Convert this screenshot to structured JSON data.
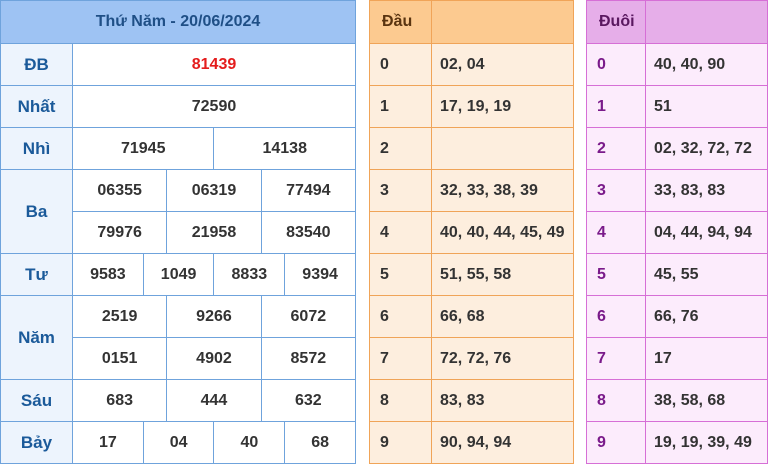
{
  "results": {
    "title": "Thứ Năm - 20/06/2024",
    "rows": {
      "db": {
        "label": "ĐB",
        "values": [
          "81439"
        ]
      },
      "nhat": {
        "label": "Nhất",
        "values": [
          "72590"
        ]
      },
      "nhi": {
        "label": "Nhì",
        "values": [
          "71945",
          "14138"
        ]
      },
      "ba": {
        "label": "Ba",
        "values": [
          "06355",
          "06319",
          "77494",
          "79976",
          "21958",
          "83540"
        ]
      },
      "tu": {
        "label": "Tư",
        "values": [
          "9583",
          "1049",
          "8833",
          "9394"
        ]
      },
      "nam": {
        "label": "Năm",
        "values": [
          "2519",
          "9266",
          "6072",
          "0151",
          "4902",
          "8572"
        ]
      },
      "sau": {
        "label": "Sáu",
        "values": [
          "683",
          "444",
          "632"
        ]
      },
      "bay": {
        "label": "Bảy",
        "values": [
          "17",
          "04",
          "40",
          "68"
        ]
      }
    },
    "special_color": "#e41c1c"
  },
  "dau": {
    "header": "Đầu",
    "rows": [
      {
        "k": "0",
        "v": "02, 04"
      },
      {
        "k": "1",
        "v": "17, 19, 19"
      },
      {
        "k": "2",
        "v": ""
      },
      {
        "k": "3",
        "v": "32, 33, 38, 39"
      },
      {
        "k": "4",
        "v": "40, 40, 44, 45, 49"
      },
      {
        "k": "5",
        "v": "51, 55, 58"
      },
      {
        "k": "6",
        "v": "66, 68"
      },
      {
        "k": "7",
        "v": "72, 72, 76"
      },
      {
        "k": "8",
        "v": "83, 83"
      },
      {
        "k": "9",
        "v": "90, 94, 94"
      }
    ]
  },
  "duoi": {
    "header": "Đuôi",
    "rows": [
      {
        "k": "0",
        "v": "40, 40, 90"
      },
      {
        "k": "1",
        "v": "51"
      },
      {
        "k": "2",
        "v": "02, 32, 72, 72"
      },
      {
        "k": "3",
        "v": "33, 83, 83"
      },
      {
        "k": "4",
        "v": "04, 44, 94, 94"
      },
      {
        "k": "5",
        "v": "45, 55"
      },
      {
        "k": "6",
        "v": "66, 76"
      },
      {
        "k": "7",
        "v": "17"
      },
      {
        "k": "8",
        "v": "38, 58, 68"
      },
      {
        "k": "9",
        "v": "19, 19, 39, 49"
      }
    ]
  }
}
